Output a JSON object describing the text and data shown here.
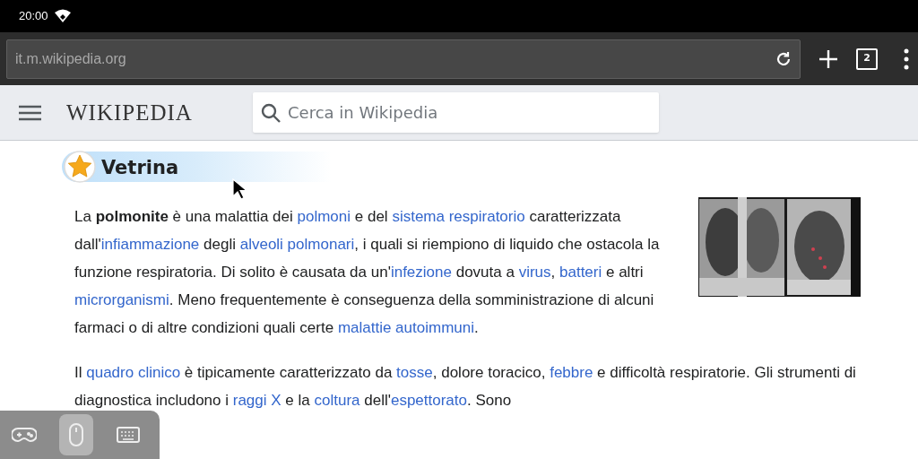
{
  "status_bar": {
    "time": "20:00"
  },
  "browser": {
    "url": "it.m.wikipedia.org",
    "tab_count": "2"
  },
  "wiki_header": {
    "logo": "WIKIPEDIA",
    "search_placeholder": "Cerca in Wikipedia"
  },
  "section": {
    "title": "Vetrina"
  },
  "paragraphs": [
    [
      {
        "kind": "plain",
        "text": "La "
      },
      {
        "kind": "bold",
        "text": "polmonite"
      },
      {
        "kind": "plain",
        "text": " è una malattia dei "
      },
      {
        "kind": "link",
        "text": "polmoni"
      },
      {
        "kind": "plain",
        "text": " e del "
      },
      {
        "kind": "link",
        "text": "sistema respiratorio"
      },
      {
        "kind": "plain",
        "text": " caratterizzata dall'"
      },
      {
        "kind": "link",
        "text": "infiammazione"
      },
      {
        "kind": "plain",
        "text": " degli "
      },
      {
        "kind": "link",
        "text": "alveoli polmonari"
      },
      {
        "kind": "plain",
        "text": ", i quali si riempiono di liquido che ostacola la funzione respiratoria. Di solito è causata da un'"
      },
      {
        "kind": "link",
        "text": "infezione"
      },
      {
        "kind": "plain",
        "text": " dovuta a "
      },
      {
        "kind": "link",
        "text": "virus"
      },
      {
        "kind": "plain",
        "text": ", "
      },
      {
        "kind": "link",
        "text": "batteri"
      },
      {
        "kind": "plain",
        "text": " e altri "
      },
      {
        "kind": "link",
        "text": "microrganismi"
      },
      {
        "kind": "plain",
        "text": ". Meno frequentemente è conseguenza della somministrazione di alcuni farmaci o di altre condizioni quali certe "
      },
      {
        "kind": "link",
        "text": "malattie autoimmuni"
      },
      {
        "kind": "plain",
        "text": "."
      }
    ],
    [
      {
        "kind": "plain",
        "text": "Il "
      },
      {
        "kind": "link",
        "text": "quadro clinico"
      },
      {
        "kind": "plain",
        "text": " è tipicamente caratterizzato da "
      },
      {
        "kind": "link",
        "text": "tosse"
      },
      {
        "kind": "plain",
        "text": ", dolore toracico, "
      },
      {
        "kind": "link",
        "text": "febbre"
      },
      {
        "kind": "plain",
        "text": " e difficoltà respiratorie. Gli strumenti di diagnostica includono i "
      },
      {
        "kind": "link",
        "text": "raggi X"
      },
      {
        "kind": "plain",
        "text": " e la "
      },
      {
        "kind": "link",
        "text": "coltura"
      },
      {
        "kind": "plain",
        "text": " dell'"
      },
      {
        "kind": "link",
        "text": "espettorato"
      },
      {
        "kind": "plain",
        "text": ". Sono"
      }
    ]
  ],
  "overlay_toolbar": [
    {
      "kind": "gamepad",
      "selected": false
    },
    {
      "kind": "mouse",
      "selected": true
    },
    {
      "kind": "keyboard",
      "selected": false
    }
  ]
}
